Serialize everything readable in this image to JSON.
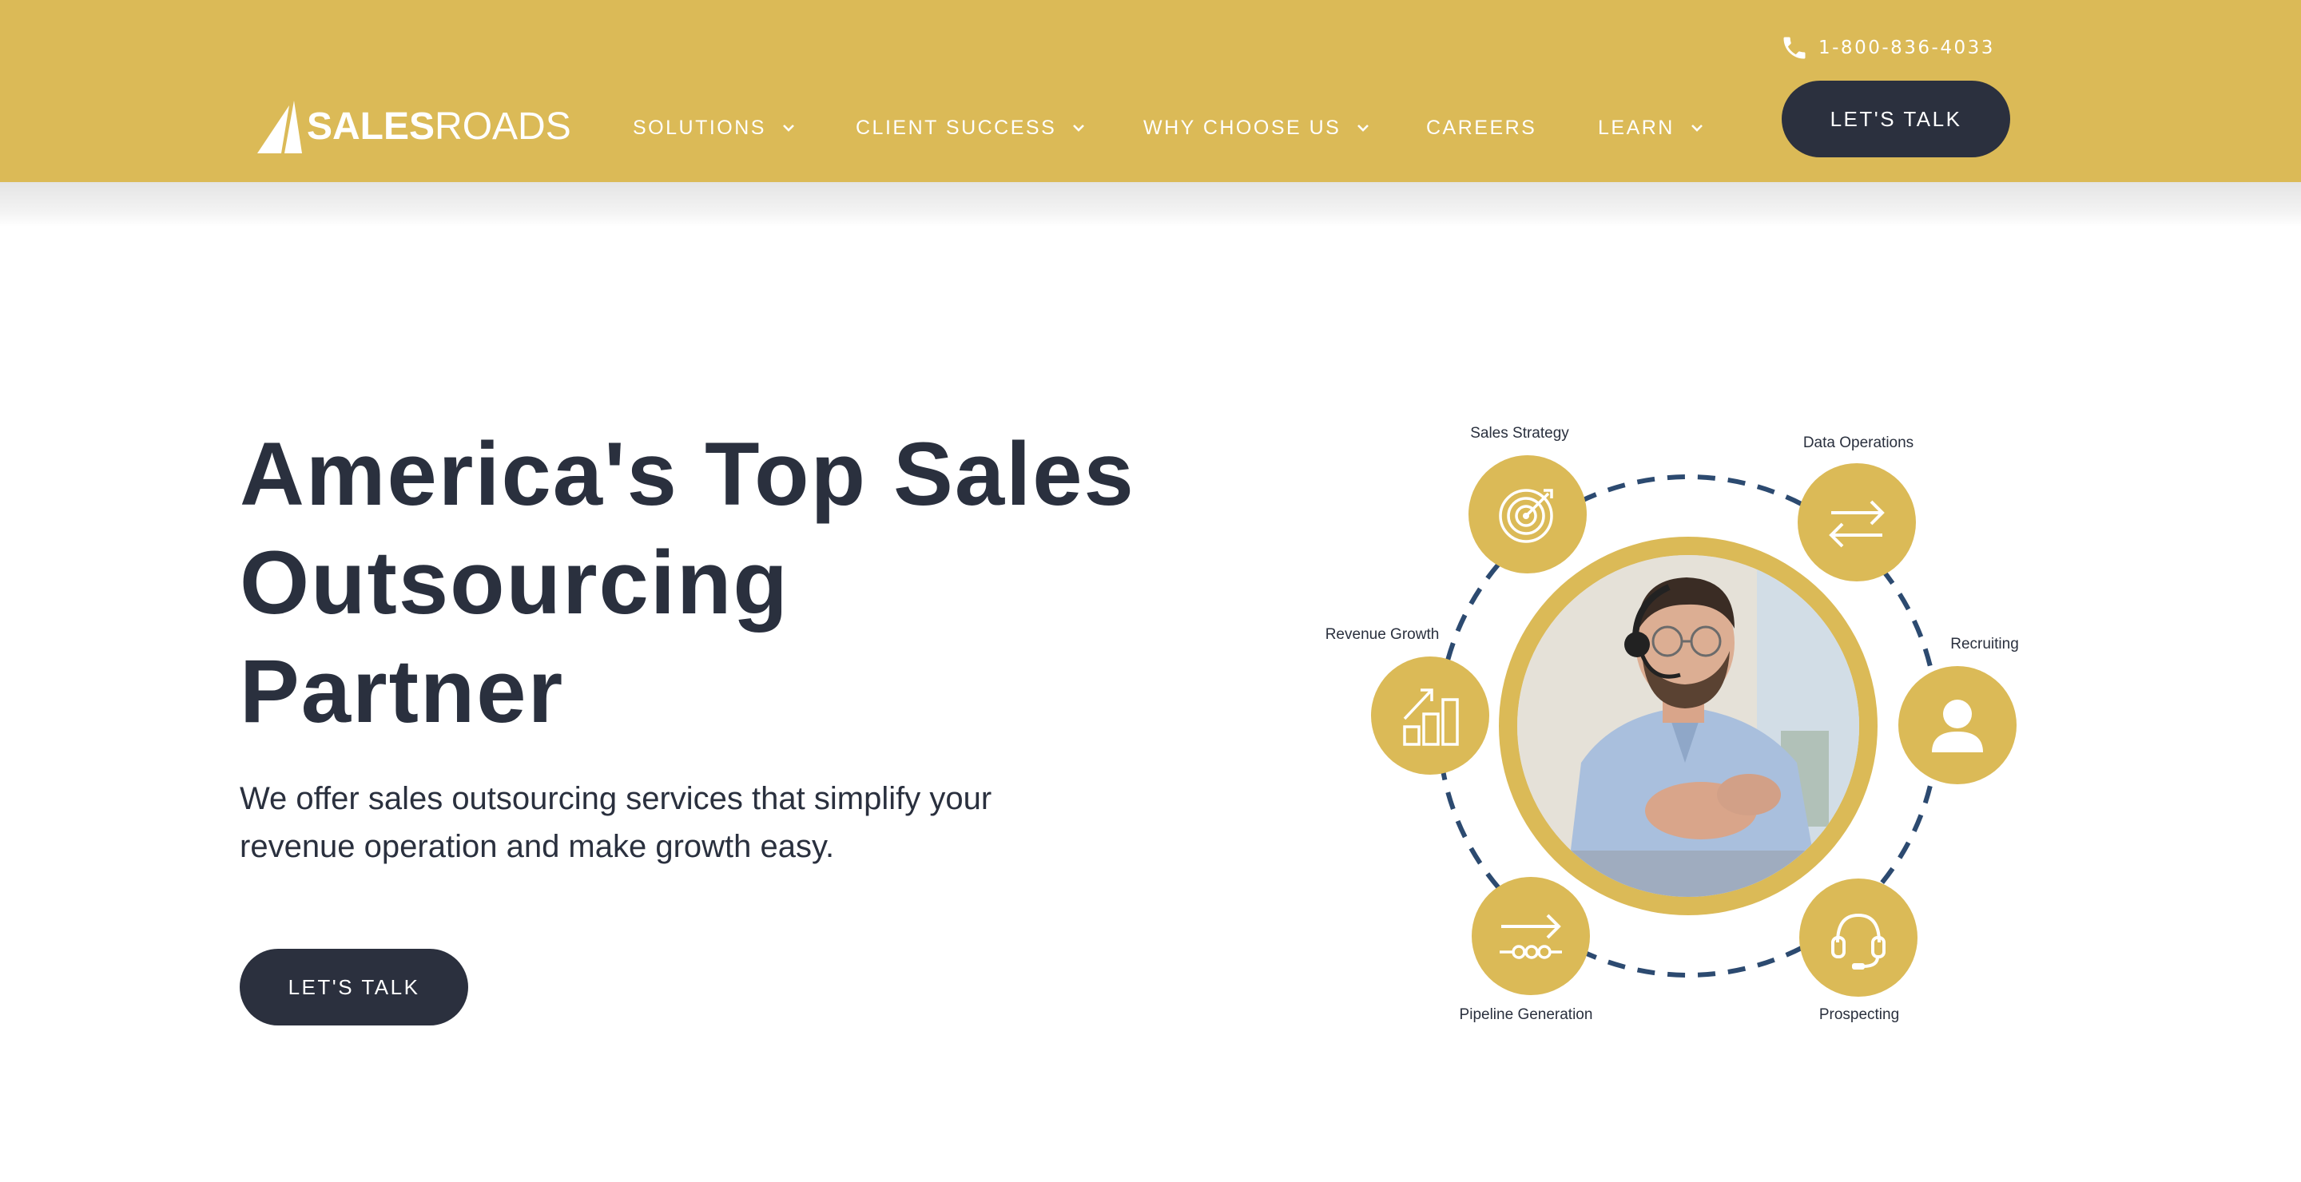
{
  "header": {
    "logo": {
      "bold": "SALES",
      "light": "ROADS"
    },
    "phone": "1-800-836-4033",
    "cta": "LET'S TALK",
    "nav": [
      {
        "label": "SOLUTIONS",
        "dropdown": true
      },
      {
        "label": "CLIENT SUCCESS",
        "dropdown": true
      },
      {
        "label": "WHY CHOOSE US",
        "dropdown": true
      },
      {
        "label": "CAREERS",
        "dropdown": false
      },
      {
        "label": "LEARN",
        "dropdown": true
      }
    ]
  },
  "hero": {
    "title_lines": [
      "America's Top Sales",
      "Outsourcing",
      "Partner"
    ],
    "subtitle_lines": [
      "We offer sales outsourcing services that simplify your",
      "revenue operation and make growth easy."
    ],
    "cta": "LET'S TALK"
  },
  "diagram": {
    "services": [
      {
        "label": "Sales Strategy",
        "icon": "target-icon"
      },
      {
        "label": "Data Operations",
        "icon": "swap-arrows-icon"
      },
      {
        "label": "Recruiting",
        "icon": "person-icon"
      },
      {
        "label": "Prospecting",
        "icon": "headset-icon"
      },
      {
        "label": "Pipeline Generation",
        "icon": "pipeline-arrow-icon"
      },
      {
        "label": "Revenue Growth",
        "icon": "growth-chart-icon"
      }
    ]
  },
  "colors": {
    "brand_gold": "#dbba57",
    "navy": "#2b303e",
    "dashed_circle": "#2c4a70",
    "white": "#ffffff"
  }
}
